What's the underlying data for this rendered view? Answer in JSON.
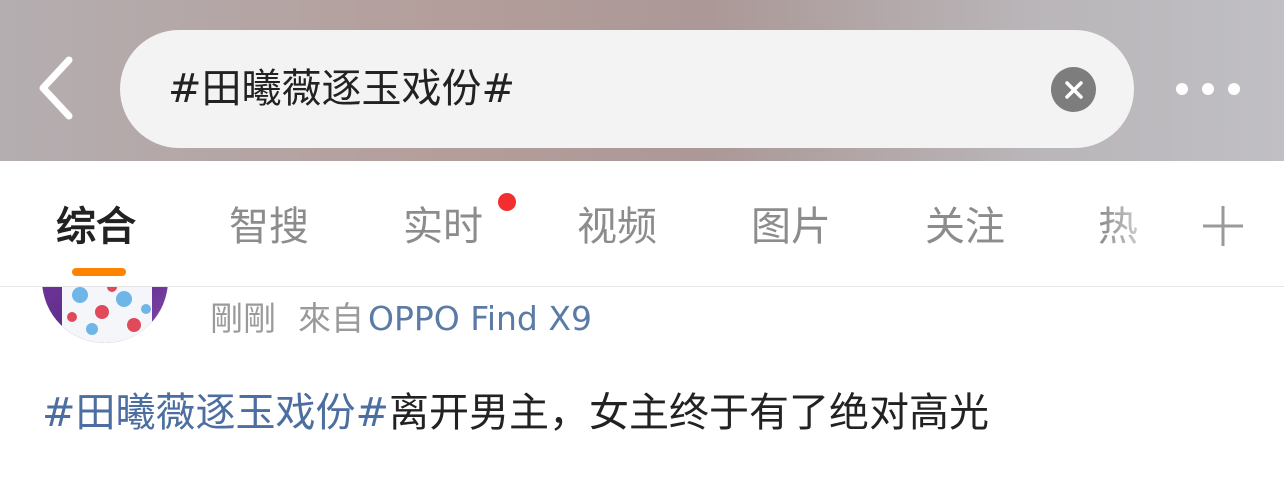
{
  "header": {
    "back_icon": "chevron-left-icon",
    "search_query": "#田曦薇逐玉戏份#",
    "clear_icon": "close-circle-icon",
    "more_icon": "more-dots-icon"
  },
  "tabs": [
    {
      "label": "综合",
      "active": true
    },
    {
      "label": "智搜",
      "active": false
    },
    {
      "label": "实时",
      "active": false,
      "badge": true
    },
    {
      "label": "视频",
      "active": false
    },
    {
      "label": "图片",
      "active": false
    },
    {
      "label": "关注",
      "active": false
    },
    {
      "label": "热",
      "active": false
    }
  ],
  "tab_plus_icon": "plus-icon",
  "post": {
    "time": "剛剛",
    "from_label": "來自",
    "device": "OPPO Find X9",
    "hashtag": "#田曦薇逐玉戏份#",
    "text": "离开男主，女主终于有了绝对高光"
  },
  "colors": {
    "accent": "#ff8200",
    "badge": "#f22e2e",
    "link": "#4d6ea0",
    "device_link": "#5b7aa6"
  }
}
